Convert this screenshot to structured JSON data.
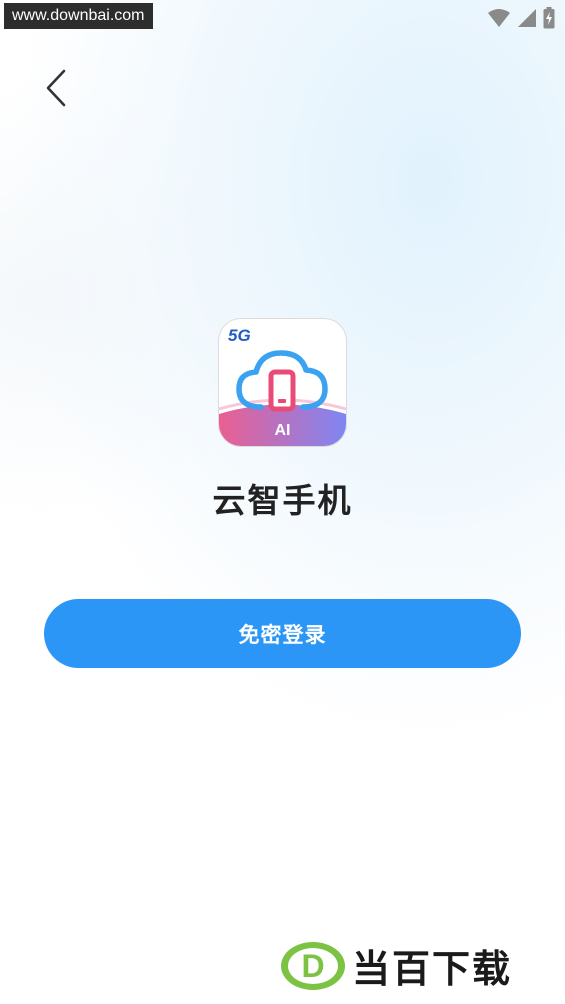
{
  "status_bar": {
    "watermark_text": "www.downbai.com",
    "icons": [
      "wifi-icon",
      "cellular-signal-icon",
      "battery-charging-icon"
    ]
  },
  "navigation": {
    "back_icon": "chevron-left-icon"
  },
  "app": {
    "logo_badge": "5G",
    "logo_label": "AI",
    "name": "云智手机"
  },
  "actions": {
    "login_label": "免密登录"
  },
  "brand_watermark": {
    "letter": "D",
    "text": "当百下载"
  },
  "colors": {
    "primary": "#2c96f7",
    "title": "#222222",
    "logo_gradient_start": "#ea5f92",
    "logo_gradient_end": "#7f86f2",
    "logo_cloud": "#3aa2f0",
    "logo_phone": "#e84b76"
  }
}
